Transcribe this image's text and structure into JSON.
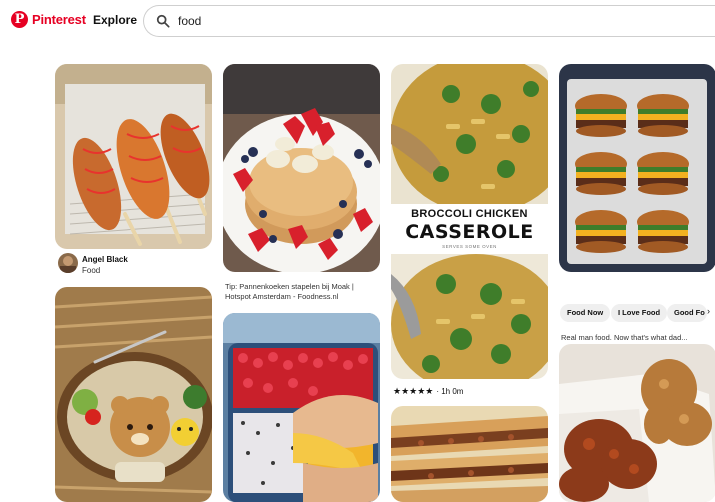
{
  "header": {
    "logo_text": "Pinterest",
    "explore_label": "Explore",
    "search_value": "food"
  },
  "pins": {
    "corndog": {
      "author": "Angel Black",
      "board": "Food"
    },
    "pancakes": {
      "caption_line1": "Tip: Pannenkoeken stapelen bij Moak |",
      "caption_line2": "Hotspot Amsterdam - Foodness.nl"
    },
    "casserole": {
      "title_line1": "BROCCOLI CHICKEN",
      "title_line2": "CASSEROLE",
      "subtitle": "SERVES SOME OVEN",
      "stars": "★★★★★",
      "time": "· 1h 0m"
    },
    "burgers": {
      "chips": [
        "Food Now",
        "I Love Food",
        "Good Fo"
      ],
      "caption": "Real man food. Now that's what dad..."
    }
  },
  "icons": {
    "search": "search-icon",
    "chevron": "chevron-right-icon",
    "logo": "pinterest-logo-icon"
  },
  "colors": {
    "brand": "#e60023",
    "chip_bg": "#efefef"
  }
}
